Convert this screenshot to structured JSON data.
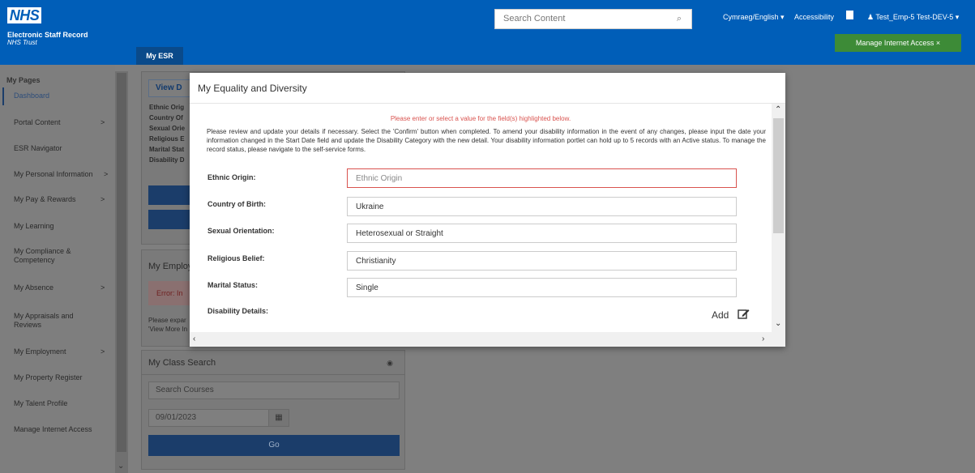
{
  "header": {
    "logo": "NHS",
    "org_name": "Electronic Staff Record",
    "org_sub": "NHS Trust",
    "search_placeholder": "Search Content",
    "language": "Cymraeg/English ▾",
    "accessibility": "Accessibility",
    "user": "♟ Test_Emp-5 Test-DEV-5 ▾",
    "manage_internet": "Manage Internet Access ×",
    "tab": "My ESR",
    "colors": {
      "brand": "#005eb8",
      "manage": "#3d8b37"
    }
  },
  "sidebar": {
    "title": "My Pages",
    "items": [
      {
        "label": "Dashboard",
        "chevron": ""
      },
      {
        "label": "Portal Content",
        "chevron": ">"
      },
      {
        "label": "ESR Navigator",
        "chevron": ""
      },
      {
        "label": "My Personal Information",
        "chevron": ">"
      },
      {
        "label": "My Pay & Rewards",
        "chevron": ">"
      },
      {
        "label": "My Learning",
        "chevron": ""
      },
      {
        "label": "My Compliance & Competency",
        "chevron": ""
      },
      {
        "label": "My Absence",
        "chevron": ">"
      },
      {
        "label": "My Appraisals and Reviews",
        "chevron": ""
      },
      {
        "label": "My Employment",
        "chevron": ">"
      },
      {
        "label": "My Property Register",
        "chevron": ""
      },
      {
        "label": "My Talent Profile",
        "chevron": ""
      },
      {
        "label": "Manage Internet Access",
        "chevron": ""
      }
    ]
  },
  "background": {
    "view_button": "View D",
    "labels": [
      "Ethnic Orig",
      "Country Of",
      "Sexual Orie",
      "Religious E",
      "Marital Stat",
      "Disability D"
    ],
    "employment_title": "My Employ",
    "error_text": "Error: In",
    "emp_text_1": "Please expar",
    "emp_text_2": "'View More In",
    "class_search_title": "My Class Search",
    "search_courses_placeholder": "Search Courses",
    "date_value": "09/01/2023",
    "go_label": "Go"
  },
  "modal": {
    "title": "My Equality and Diversity",
    "error_message": "Please enter or select a value for the field(s) highlighted below.",
    "intro": "Please review and update your details if necessary. Select the 'Confirm' button when completed. To amend your disability information in the event of any changes, please input the date your information changed in the Start Date field and update the Disability Category with the new detail. Your disability information portlet can hold up to 5 records with an Active status. To manage the record status, please navigate to the self-service forms.",
    "fields": [
      {
        "label": "Ethnic Origin:",
        "value": "",
        "placeholder": "Ethnic Origin",
        "error": true
      },
      {
        "label": "Country of Birth:",
        "value": "Ukraine",
        "placeholder": "",
        "error": false
      },
      {
        "label": "Sexual Orientation:",
        "value": "Heterosexual or Straight",
        "placeholder": "",
        "error": false
      },
      {
        "label": "Religious Belief:",
        "value": "Christianity",
        "placeholder": "",
        "error": false
      },
      {
        "label": "Marital Status:",
        "value": "Single",
        "placeholder": "",
        "error": false
      }
    ],
    "disability_label": "Disability Details:",
    "add_label": "Add",
    "error_color": "#d9534f"
  }
}
